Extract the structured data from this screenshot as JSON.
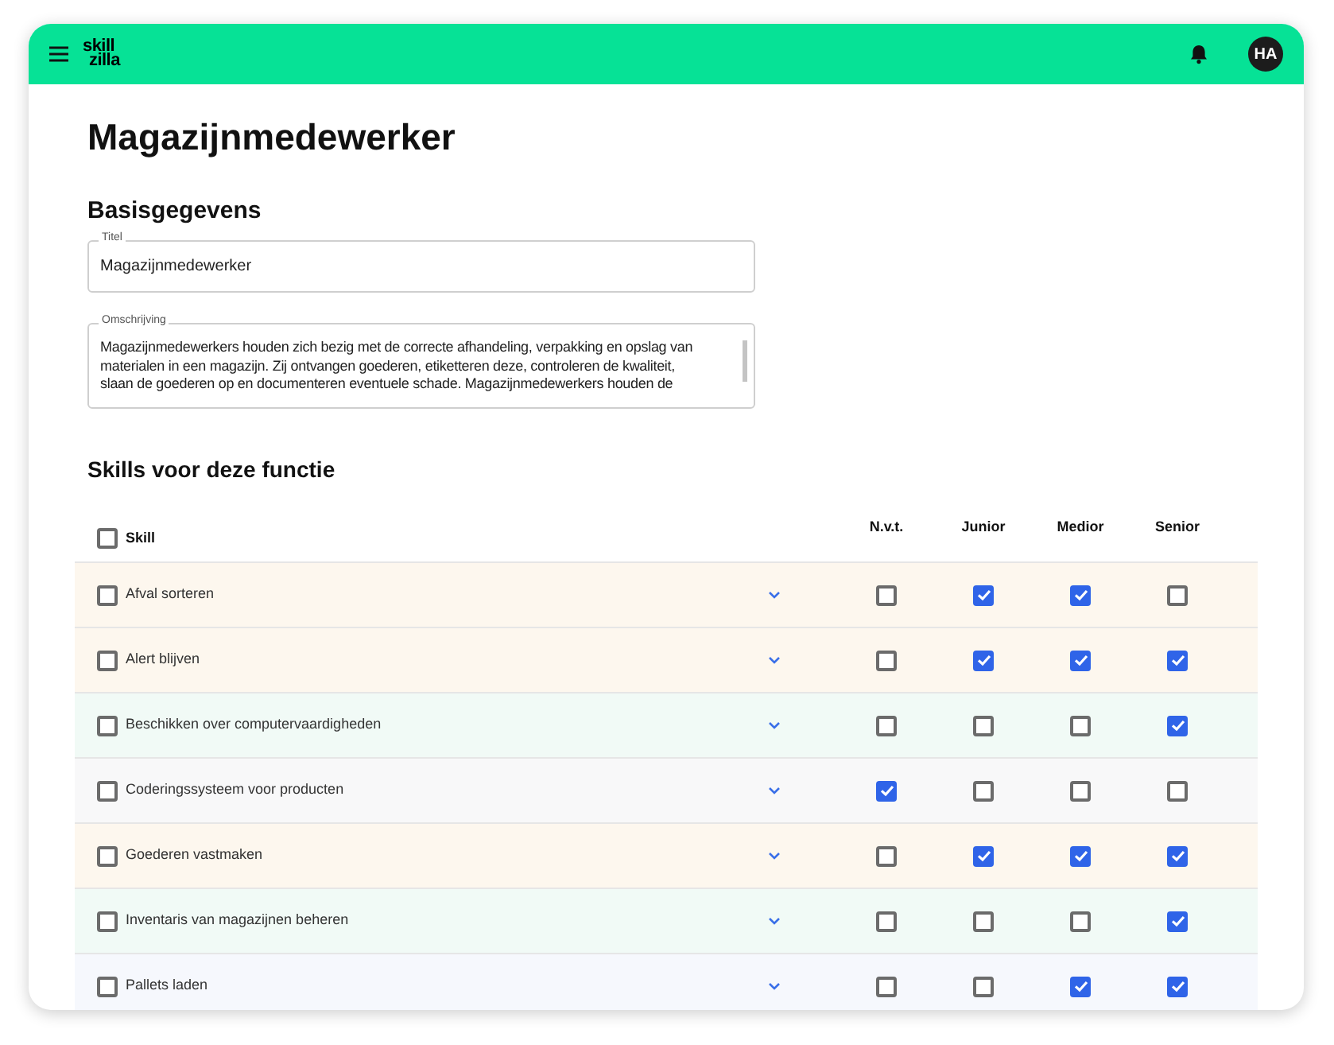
{
  "header": {
    "logo": {
      "line_1": "skill",
      "line_2": "zilla"
    },
    "avatar": "HA"
  },
  "page_title": "Magazijnmedewerker",
  "basic": {
    "heading": "Basisgegevens",
    "title_field": {
      "label": "Titel",
      "value": "Magazijnmedewerker"
    },
    "description_field": {
      "label": "Omschrijving",
      "lines": [
        "Magazijnmedewerkers houden zich bezig met de correcte afhandeling, verpakking en opslag van",
        "materialen in een magazijn. Zij ontvangen goederen, etiketteren deze, controleren de kwaliteit,",
        "slaan de goederen op en documenteren eventuele schade. Magazijnmedewerkers houden de"
      ]
    }
  },
  "skills": {
    "heading": "Skills voor deze functie",
    "columns": [
      {
        "label": "Skill",
        "selected": false
      },
      {
        "label": "N.v.t."
      },
      {
        "label": "Junior"
      },
      {
        "label": "Medior"
      },
      {
        "label": "Senior"
      }
    ],
    "rows": [
      {
        "name": "Afval sorteren",
        "color": "#fdf7ee",
        "selected": false,
        "levels": [
          {
            "checked": false
          },
          {
            "checked": true
          },
          {
            "checked": true
          },
          {
            "checked": false
          }
        ]
      },
      {
        "name": "Alert blijven",
        "color": "#fdf7ee",
        "selected": false,
        "levels": [
          {
            "checked": false
          },
          {
            "checked": true
          },
          {
            "checked": true
          },
          {
            "checked": true
          }
        ]
      },
      {
        "name": "Beschikken over computervaardigheden",
        "color": "#f1faf6",
        "selected": false,
        "levels": [
          {
            "checked": false
          },
          {
            "checked": false
          },
          {
            "checked": false
          },
          {
            "checked": true
          }
        ]
      },
      {
        "name": "Coderingssysteem voor producten",
        "color": "#f8f8f9",
        "selected": false,
        "levels": [
          {
            "checked": true
          },
          {
            "checked": false
          },
          {
            "checked": false
          },
          {
            "checked": false
          }
        ]
      },
      {
        "name": "Goederen vastmaken",
        "color": "#fdf7ee",
        "selected": false,
        "levels": [
          {
            "checked": false
          },
          {
            "checked": true
          },
          {
            "checked": true
          },
          {
            "checked": true
          }
        ]
      },
      {
        "name": "Inventaris van magazijnen beheren",
        "color": "#f1faf6",
        "selected": false,
        "levels": [
          {
            "checked": false
          },
          {
            "checked": false
          },
          {
            "checked": false
          },
          {
            "checked": true
          }
        ]
      },
      {
        "name": "Pallets laden",
        "color": "#f6f8fd",
        "selected": false,
        "levels": [
          {
            "checked": false
          },
          {
            "checked": false
          },
          {
            "checked": true
          },
          {
            "checked": true
          }
        ]
      }
    ]
  }
}
